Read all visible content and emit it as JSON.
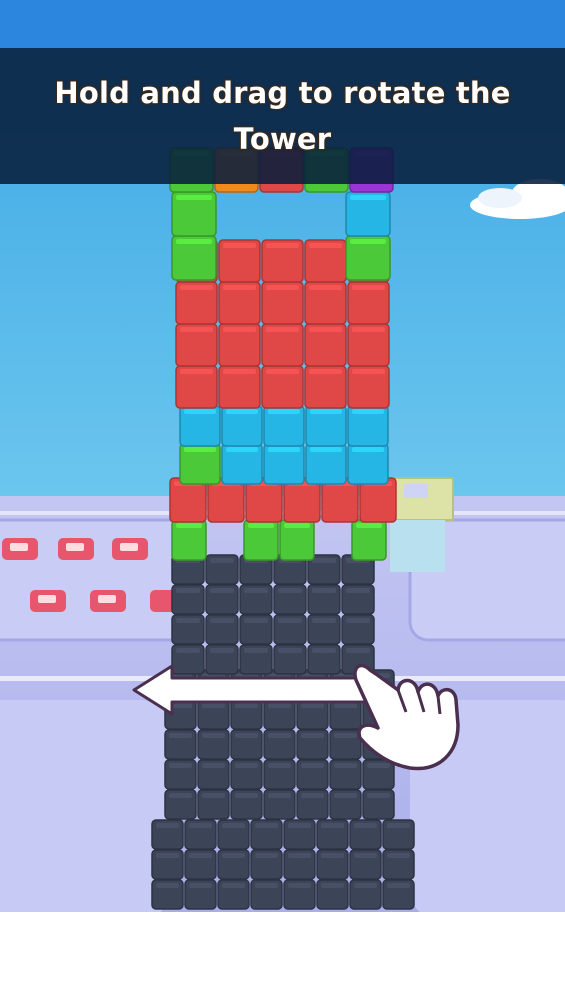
{
  "hint": {
    "text": "Hold and drag to rotate the Tower"
  },
  "colors": {
    "sky": "#52b8ea",
    "ground": "#bcc0f0",
    "road": "#9ea3e6",
    "red": "#e04848",
    "blue": "#25b6e6",
    "green": "#4cc938",
    "dark": "#3c4458",
    "purple": "#9b35d6",
    "orange": "#f08a1c"
  },
  "icons": {
    "hand": "drag-hand-icon",
    "arrow": "swipe-left-arrow-icon"
  }
}
